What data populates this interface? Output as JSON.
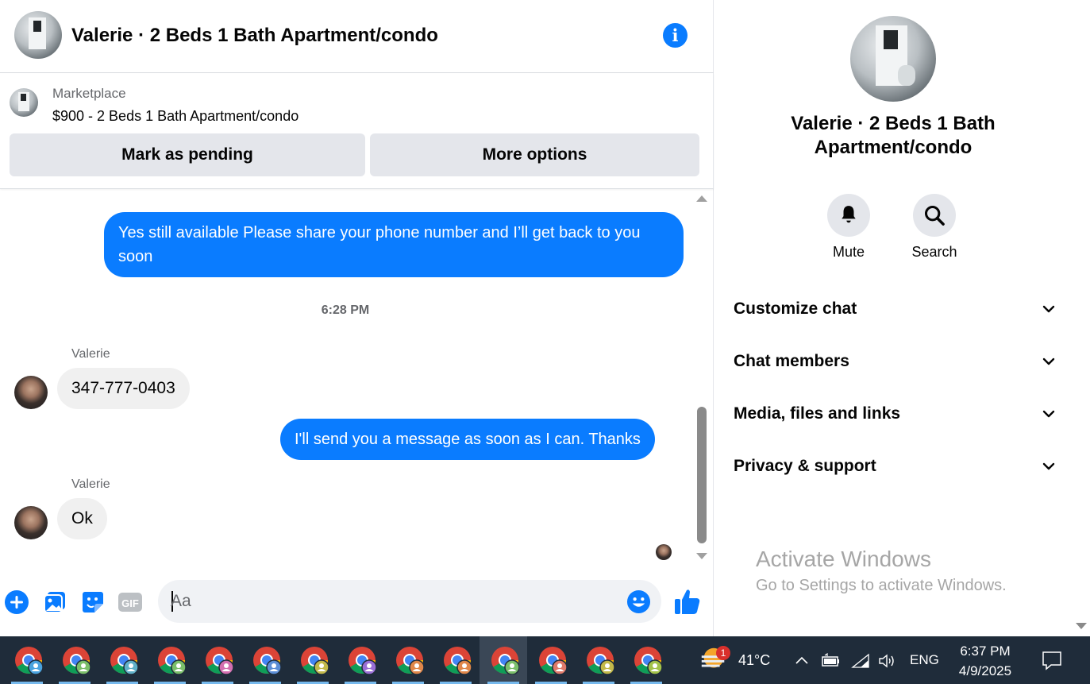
{
  "header": {
    "title": "Valerie · 2 Beds 1 Bath Apartment/condo"
  },
  "marketplace": {
    "label": "Marketplace",
    "item": "$900 - 2 Beds 1 Bath Apartment/condo",
    "mark_pending": "Mark as pending",
    "more_options": "More options"
  },
  "messages": {
    "out_1": "Yes still available Please share your phone number and I’ll get back to you soon",
    "timestamp": "6:28 PM",
    "sender_1": "Valerie",
    "in_1": "347-777-0403",
    "out_2": "I'll send you a message as soon as I can. Thanks",
    "sender_2": "Valerie",
    "in_2": "Ok"
  },
  "composer": {
    "placeholder": "Aa"
  },
  "panel": {
    "title": "Valerie · 2 Beds 1 Bath Apartment/condo",
    "mute": "Mute",
    "search": "Search",
    "sections": [
      "Customize chat",
      "Chat members",
      "Media, files and links",
      "Privacy & support"
    ]
  },
  "watermark": {
    "line1": "Activate Windows",
    "line2": "Go to Settings to activate Windows."
  },
  "taskbar": {
    "weather": "41°C",
    "weather_badge": "1",
    "language": "ENG",
    "time": "6:37 PM",
    "date": "4/9/2025",
    "app_count": 14
  },
  "colors": {
    "accent": "#0a7cff",
    "bubble_in": "#f0f0f0",
    "button_bg": "#e4e6eb",
    "taskbar": "#1f2c3a"
  },
  "icons": [
    "info-icon",
    "plus-icon",
    "photo-icon",
    "sticker-icon",
    "gif-icon",
    "emoji-icon",
    "thumbs-up-icon",
    "bell-icon",
    "search-icon",
    "chevron-down-icon",
    "chrome-icon",
    "weather-icon",
    "chevron-up-icon",
    "battery-icon",
    "wifi-icon",
    "volume-icon",
    "notification-icon"
  ]
}
